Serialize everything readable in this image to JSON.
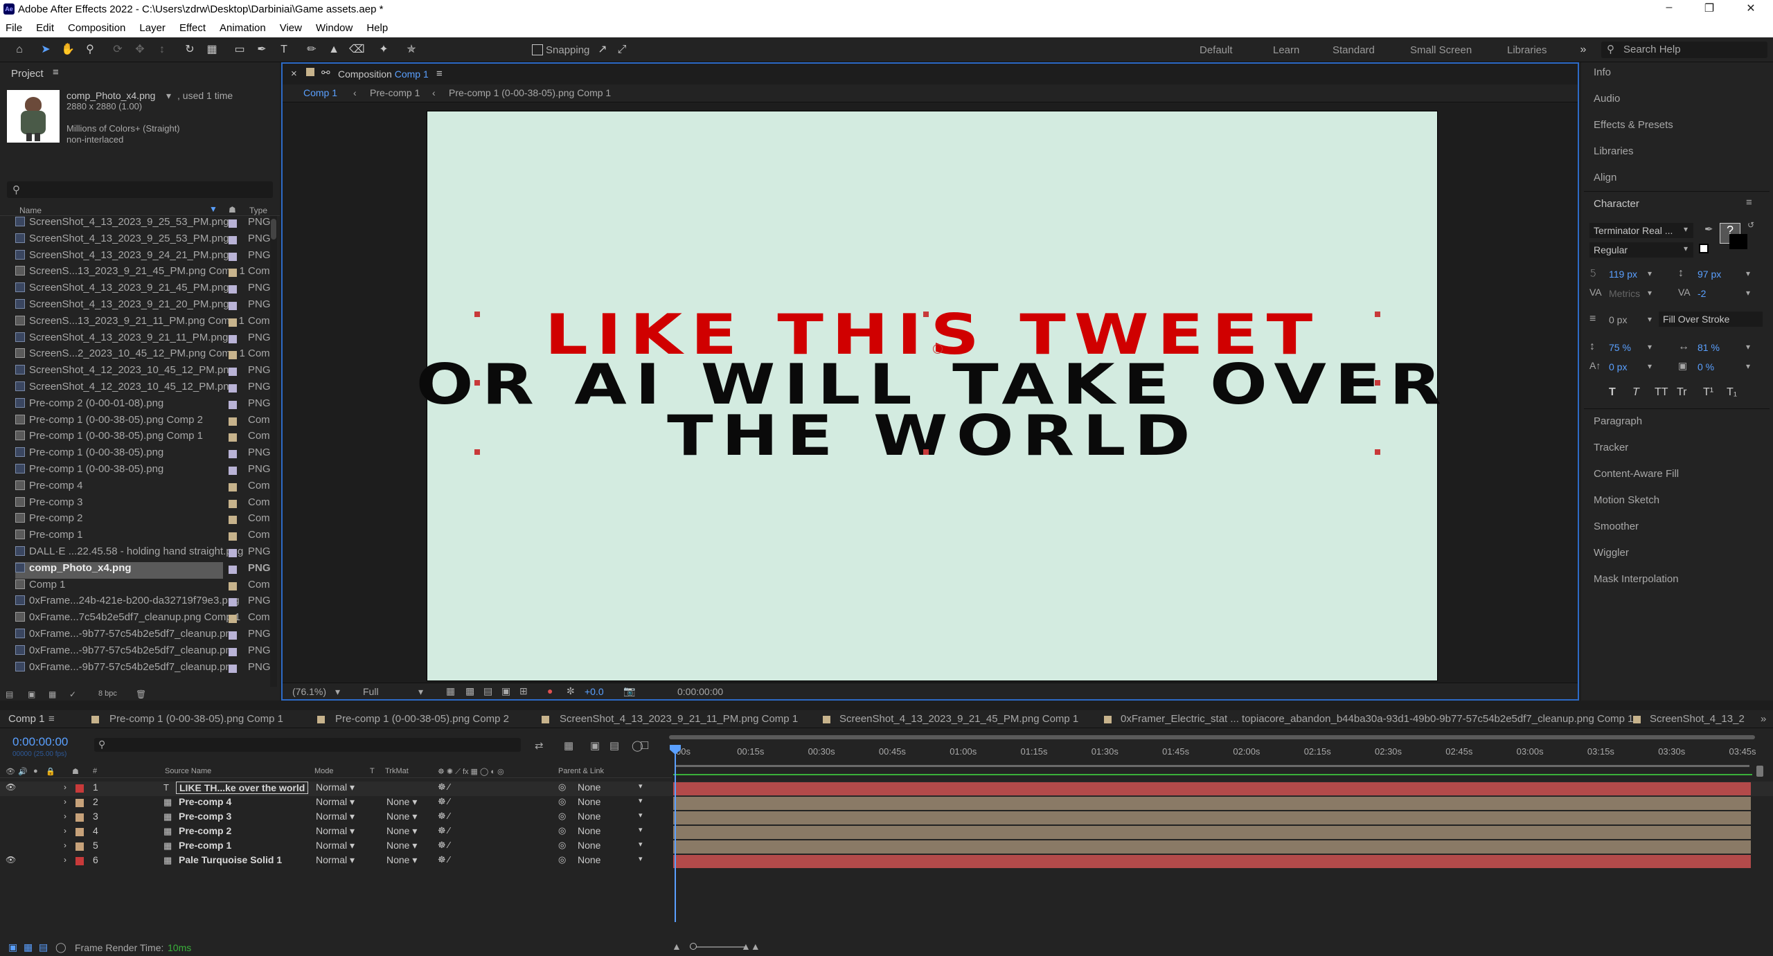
{
  "window": {
    "title": "Adobe After Effects 2022 - C:\\Users\\zdrw\\Desktop\\Darbiniai\\Game assets.aep *",
    "app_icon": "Ae"
  },
  "menu": [
    "File",
    "Edit",
    "Composition",
    "Layer",
    "Effect",
    "Animation",
    "View",
    "Window",
    "Help"
  ],
  "toolbar": {
    "snapping": "Snapping",
    "workspaces": [
      "Default",
      "Learn",
      "Standard",
      "Small Screen",
      "Libraries"
    ],
    "search_placeholder": "Search Help"
  },
  "project": {
    "tab": "Project",
    "preview": {
      "name": "comp_Photo_x4.png",
      "used": ", used 1 time",
      "dims": "2880 x 2880 (1.00)",
      "colors": "Millions of Colors+ (Straight)",
      "interlace": "non-interlaced"
    },
    "col_name": "Name",
    "col_type": "Type",
    "items": [
      {
        "name": "ScreenShot_4_13_2023_9_25_53_PM.png",
        "type": "PNG",
        "comp": false
      },
      {
        "name": "ScreenShot_4_13_2023_9_25_53_PM.png",
        "type": "PNG",
        "comp": false
      },
      {
        "name": "ScreenShot_4_13_2023_9_24_21_PM.png",
        "type": "PNG",
        "comp": false
      },
      {
        "name": "ScreenS...13_2023_9_21_45_PM.png Comp 1",
        "type": "Com",
        "comp": true
      },
      {
        "name": "ScreenShot_4_13_2023_9_21_45_PM.png",
        "type": "PNG",
        "comp": false
      },
      {
        "name": "ScreenShot_4_13_2023_9_21_20_PM.png",
        "type": "PNG",
        "comp": false
      },
      {
        "name": "ScreenS...13_2023_9_21_11_PM.png Comp 1",
        "type": "Com",
        "comp": true
      },
      {
        "name": "ScreenShot_4_13_2023_9_21_11_PM.png",
        "type": "PNG",
        "comp": false
      },
      {
        "name": "ScreenS...2_2023_10_45_12_PM.png Comp 1",
        "type": "Com",
        "comp": true
      },
      {
        "name": "ScreenShot_4_12_2023_10_45_12_PM.png",
        "type": "PNG",
        "comp": false
      },
      {
        "name": "ScreenShot_4_12_2023_10_45_12_PM.png",
        "type": "PNG",
        "comp": false
      },
      {
        "name": "Pre-comp 2 (0-00-01-08).png",
        "type": "PNG",
        "comp": false
      },
      {
        "name": "Pre-comp 1 (0-00-38-05).png Comp 2",
        "type": "Com",
        "comp": true
      },
      {
        "name": "Pre-comp 1 (0-00-38-05).png Comp 1",
        "type": "Com",
        "comp": true
      },
      {
        "name": "Pre-comp 1 (0-00-38-05).png",
        "type": "PNG",
        "comp": false
      },
      {
        "name": "Pre-comp 1 (0-00-38-05).png",
        "type": "PNG",
        "comp": false
      },
      {
        "name": "Pre-comp 4",
        "type": "Com",
        "comp": true
      },
      {
        "name": "Pre-comp 3",
        "type": "Com",
        "comp": true
      },
      {
        "name": "Pre-comp 2",
        "type": "Com",
        "comp": true
      },
      {
        "name": "Pre-comp 1",
        "type": "Com",
        "comp": true
      },
      {
        "name": "DALL·E ...22.45.58 - holding hand straight.png",
        "type": "PNG",
        "comp": false
      },
      {
        "name": "comp_Photo_x4.png",
        "type": "PNG",
        "comp": false,
        "selected": true
      },
      {
        "name": "Comp 1",
        "type": "Com",
        "comp": true
      },
      {
        "name": "0xFrame...24b-421e-b200-da32719f79e3.png",
        "type": "PNG",
        "comp": false
      },
      {
        "name": "0xFrame...7c54b2e5df7_cleanup.png Comp 1",
        "type": "Com",
        "comp": true
      },
      {
        "name": "0xFrame...-9b77-57c54b2e5df7_cleanup.png",
        "type": "PNG",
        "comp": false
      },
      {
        "name": "0xFrame...-9b77-57c54b2e5df7_cleanup.png",
        "type": "PNG",
        "comp": false
      },
      {
        "name": "0xFrame...-9b77-57c54b2e5df7_cleanup.png",
        "type": "PNG",
        "comp": false
      }
    ],
    "bpc": "8 bpc"
  },
  "comp": {
    "tab_prefix": "Composition",
    "tab_name": "Comp 1",
    "breadcrumbs": [
      "Comp 1",
      "Pre-comp 1",
      "Pre-comp 1 (0-00-38-05).png Comp 1"
    ],
    "line1": "LIKE THIS TWEET",
    "line2": "OR AI WILL TAKE OVER",
    "line3": "THE WORLD",
    "zoom": "(76.1%)",
    "resolution": "Full",
    "exposure": "+0.0",
    "time": "0:00:00:00",
    "bg_color": "#d3ebe0"
  },
  "right": {
    "panels_top": [
      "Info",
      "Audio",
      "Effects & Presets",
      "Libraries",
      "Align"
    ],
    "character": {
      "title": "Character",
      "font": "Terminator Real ...",
      "style": "Regular",
      "size": "119 px",
      "leading": "97 px",
      "kerning": "Metrics",
      "tracking": "-2",
      "stroke": "0 px",
      "stroke_mode": "Fill Over Stroke",
      "vscale": "75 %",
      "hscale": "81 %",
      "baseline": "0 px",
      "tsume": "0 %",
      "styles": [
        "T",
        "T",
        "TT",
        "Tr",
        "T¹",
        "T₁"
      ]
    },
    "panels_bottom": [
      "Paragraph",
      "Tracker",
      "Content-Aware Fill",
      "Motion Sketch",
      "Smoother",
      "Wiggler",
      "Mask Interpolation"
    ]
  },
  "timeline": {
    "tabs": [
      "Comp 1",
      "Pre-comp 1 (0-00-38-05).png Comp 1",
      "Pre-comp 1 (0-00-38-05).png Comp 2",
      "ScreenShot_4_13_2023_9_21_11_PM.png Comp 1",
      "ScreenShot_4_13_2023_9_21_45_PM.png Comp 1",
      "0xFramer_Electric_stat ... topiacore_abandon_b44ba30a-93d1-49b0-9b77-57c54b2e5df7_cleanup.png Comp 1",
      "ScreenShot_4_13_2"
    ],
    "timecode": "0:00:00:00",
    "fps": "00000 (25.00 fps)",
    "headers": {
      "num": "#",
      "source": "Source Name",
      "mode": "Mode",
      "t": "T",
      "trkmat": "TrkMat",
      "parent": "Parent & Link"
    },
    "ticks": [
      "00s",
      "00:15s",
      "00:30s",
      "00:45s",
      "01:00s",
      "01:15s",
      "01:30s",
      "01:45s",
      "02:00s",
      "02:15s",
      "02:30s",
      "02:45s",
      "03:00s",
      "03:15s",
      "03:30s",
      "03:45s"
    ],
    "layers": [
      {
        "num": "1",
        "name": "LIKE TH...ke over  the world",
        "mode": "Normal",
        "trk": "",
        "parent": "None",
        "color": "#c83a3a",
        "bar": "#b34a4a",
        "text": true
      },
      {
        "num": "2",
        "name": "Pre-comp 4",
        "mode": "Normal",
        "trk": "None",
        "parent": "None",
        "color": "#c7a27a",
        "bar": "#8a7a66"
      },
      {
        "num": "3",
        "name": "Pre-comp 3",
        "mode": "Normal",
        "trk": "None",
        "parent": "None",
        "color": "#c7a27a",
        "bar": "#8a7a66"
      },
      {
        "num": "4",
        "name": "Pre-comp 2",
        "mode": "Normal",
        "trk": "None",
        "parent": "None",
        "color": "#c7a27a",
        "bar": "#8a7a66"
      },
      {
        "num": "5",
        "name": "Pre-comp 1",
        "mode": "Normal",
        "trk": "None",
        "parent": "None",
        "color": "#c7a27a",
        "bar": "#8a7a66"
      },
      {
        "num": "6",
        "name": "Pale Turquoise Solid 1",
        "mode": "Normal",
        "trk": "None",
        "parent": "None",
        "color": "#c83a3a",
        "bar": "#b34a4a"
      }
    ],
    "render_label": "Frame Render Time:",
    "render_value": "10ms"
  }
}
